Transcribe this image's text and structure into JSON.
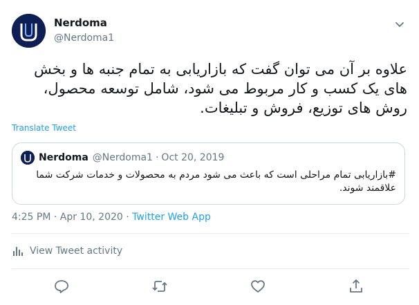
{
  "author": {
    "display_name": "Nerdoma",
    "handle": "@Nerdoma1"
  },
  "tweet": {
    "text": "علاوه بر آن می توان گفت که بازاریابی به تمام جنبه ها و بخش های یک کسب و کار مربوط می شود، شامل توسعه محصول، روش های توزیع، فروش و تبلیغات.",
    "translate_label": "Translate Tweet"
  },
  "quoted": {
    "display_name": "Nerdoma",
    "handle": "@Nerdoma1",
    "separator": "·",
    "date": "Oct 20, 2019",
    "text": "#بازاریابی تمام مراحلی است که باعث می شود مردم به محصولات و خدمات شرکت شما علاقمند شوند."
  },
  "meta": {
    "time": "4:25 PM",
    "separator": "·",
    "date": "Apr 10, 2020",
    "source": "Twitter Web App"
  },
  "activity": {
    "label": "View Tweet activity"
  },
  "icons": {
    "caret": "chevron-down-icon",
    "reply": "reply-icon",
    "retweet": "retweet-icon",
    "like": "heart-icon",
    "share": "share-icon",
    "activity": "bar-chart-icon"
  },
  "colors": {
    "accent": "#1da1f2",
    "muted": "#657786",
    "text": "#14171a",
    "border": "#ccd6dd",
    "avatar_bg": "#0d1f54"
  }
}
